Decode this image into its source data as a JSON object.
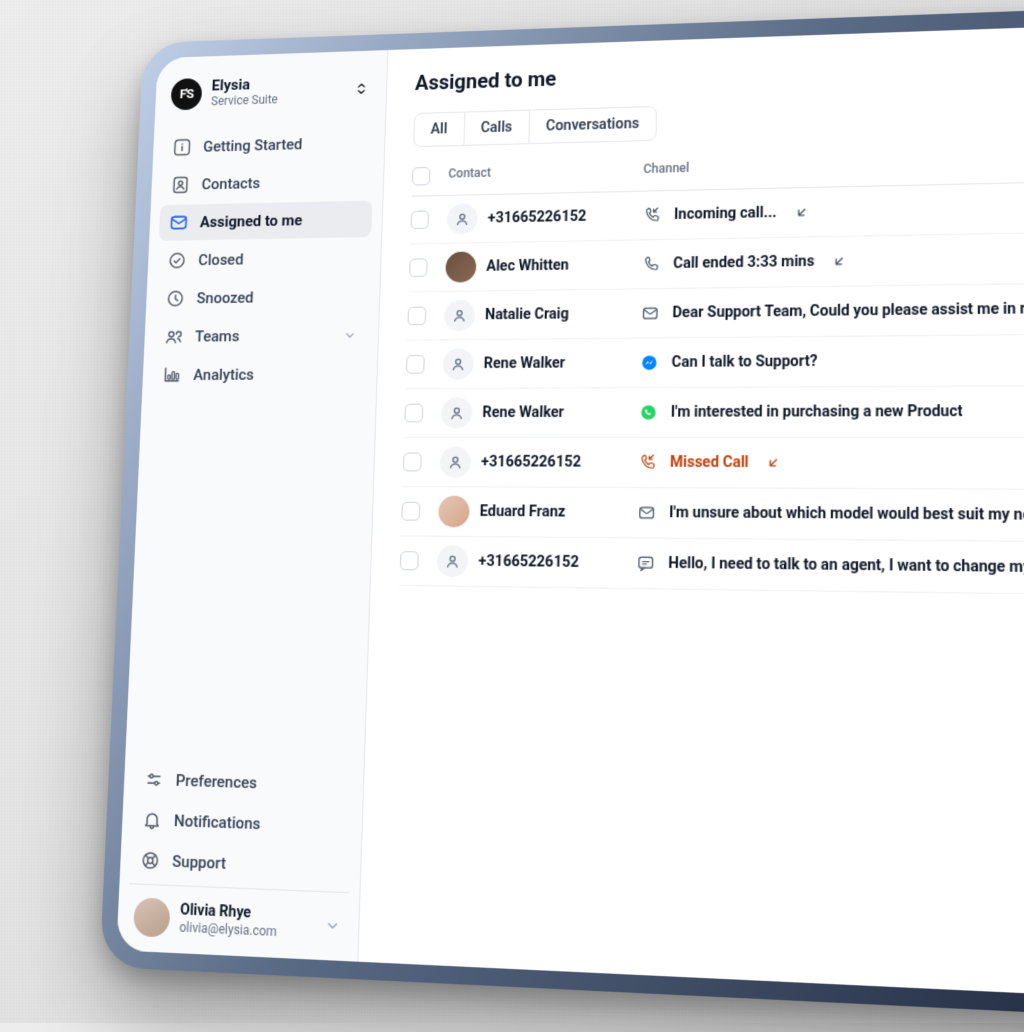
{
  "brand": {
    "logo_text": "F'S",
    "title": "Elysia",
    "subtitle": "Service Suite"
  },
  "sidebar": {
    "items": [
      {
        "label": "Getting Started",
        "icon": "info"
      },
      {
        "label": "Contacts",
        "icon": "contacts"
      },
      {
        "label": "Assigned to me",
        "icon": "mail",
        "active": true
      },
      {
        "label": "Closed",
        "icon": "check"
      },
      {
        "label": "Snoozed",
        "icon": "clock"
      },
      {
        "label": "Teams",
        "icon": "users",
        "chevron": true
      },
      {
        "label": "Analytics",
        "icon": "chart"
      }
    ],
    "footer": [
      {
        "label": "Preferences",
        "icon": "sliders"
      },
      {
        "label": "Notifications",
        "icon": "bell"
      },
      {
        "label": "Support",
        "icon": "life"
      }
    ]
  },
  "user": {
    "name": "Olivia Rhye",
    "email": "olivia@elysia.com"
  },
  "main": {
    "title": "Assigned to me",
    "tabs": [
      {
        "label": "All"
      },
      {
        "label": "Calls"
      },
      {
        "label": "Conversations"
      }
    ],
    "columns": {
      "contact": "Contact",
      "channel": "Channel"
    },
    "rows": [
      {
        "contact": "+31665226152",
        "avatar": null,
        "channel": "phone-in",
        "message": "Incoming call...",
        "style": "bold",
        "arrow": true
      },
      {
        "contact": "Alec Whitten",
        "avatar": "photo1",
        "channel": "phone",
        "message": "Call ended 3:33 mins",
        "style": "bold",
        "arrow": true
      },
      {
        "contact": "Natalie Craig",
        "avatar": null,
        "channel": "email",
        "message": "Dear Support Team, Could you please assist me in resolving this issue",
        "style": "bold"
      },
      {
        "contact": "Rene Walker",
        "avatar": null,
        "channel": "messenger",
        "message": "Can I talk to Support?",
        "style": "bold"
      },
      {
        "contact": "Rene Walker",
        "avatar": null,
        "channel": "whatsapp",
        "message": "I'm interested in purchasing a new Product",
        "style": "bold"
      },
      {
        "contact": "+31665226152",
        "avatar": null,
        "channel": "phone-in",
        "message": "Missed Call",
        "style": "missed",
        "arrow": true
      },
      {
        "contact": "Eduard Franz",
        "avatar": "photo2",
        "channel": "email",
        "message": "I'm unsure about which model would best suit my needs. Could you p",
        "style": "bold"
      },
      {
        "contact": "+31665226152",
        "avatar": null,
        "channel": "chat",
        "message": "Hello, I need to talk to an agent, I want to change my payment metho",
        "style": "bold"
      }
    ]
  }
}
